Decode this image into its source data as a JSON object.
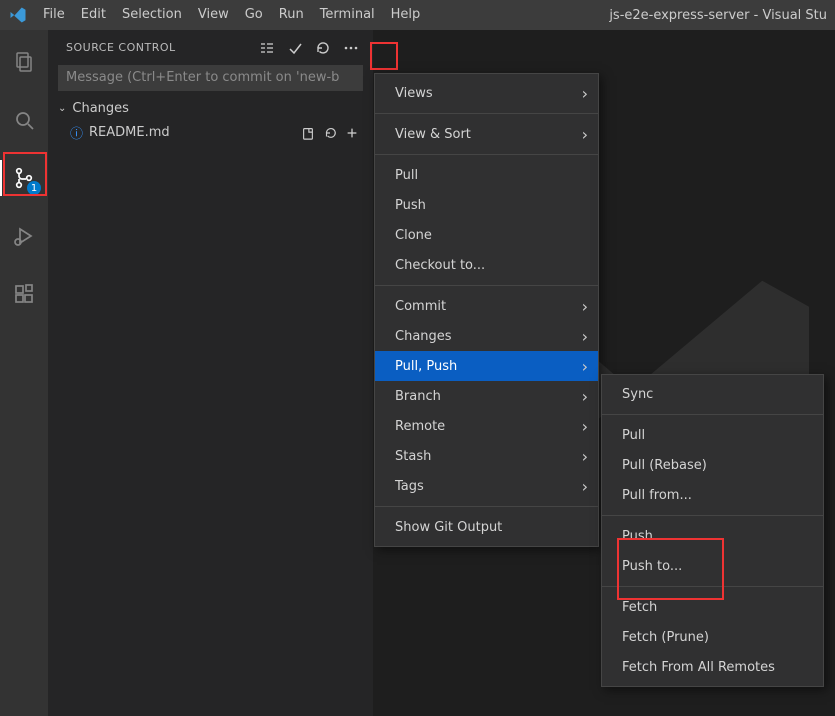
{
  "window_title": "js-e2e-express-server - Visual Stu",
  "menubar": [
    "File",
    "Edit",
    "Selection",
    "View",
    "Go",
    "Run",
    "Terminal",
    "Help"
  ],
  "activitybar": {
    "badge": "1"
  },
  "source_control": {
    "title": "SOURCE CONTROL",
    "commit_placeholder": "Message (Ctrl+Enter to commit on 'new-b",
    "section_changes": "Changes",
    "file": "README.md"
  },
  "context_main": {
    "views": "Views",
    "view_sort": "View & Sort",
    "pull": "Pull",
    "push": "Push",
    "clone": "Clone",
    "checkout": "Checkout to...",
    "commit": "Commit",
    "changes": "Changes",
    "pull_push": "Pull, Push",
    "branch": "Branch",
    "remote": "Remote",
    "stash": "Stash",
    "tags": "Tags",
    "show_git_output": "Show Git Output"
  },
  "context_sub": {
    "sync": "Sync",
    "pull": "Pull",
    "pull_rebase": "Pull (Rebase)",
    "pull_from": "Pull from...",
    "push": "Push",
    "push_to": "Push to...",
    "fetch": "Fetch",
    "fetch_prune": "Fetch (Prune)",
    "fetch_all": "Fetch From All Remotes"
  }
}
